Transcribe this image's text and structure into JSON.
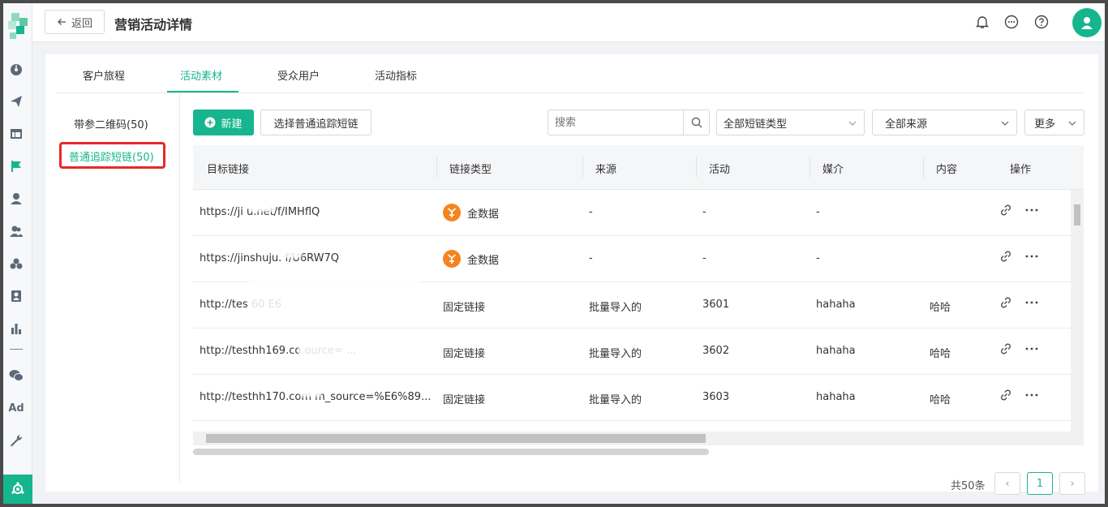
{
  "header": {
    "back_label": "返回",
    "title": "营销活动详情"
  },
  "sidebar": {
    "items": [
      "dashboard-icon",
      "send-icon",
      "layout-icon",
      "flag-icon",
      "user-icon",
      "users-icon",
      "group-icon",
      "bookmark-user-icon",
      "bar-chart-icon",
      "wechat-icon",
      "ad-icon",
      "wrench-icon"
    ],
    "ad_text": "Ad"
  },
  "tabs": [
    {
      "label": "客户旅程"
    },
    {
      "label": "活动素材"
    },
    {
      "label": "受众用户"
    },
    {
      "label": "活动指标"
    }
  ],
  "left_menu": [
    {
      "label": "带参二维码(50)"
    },
    {
      "label": "普通追踪短链(50)"
    }
  ],
  "toolbar": {
    "new_label": "新建",
    "select_label": "选择普通追踪短链",
    "search_placeholder": "搜索",
    "filter_type": "全部短链类型",
    "filter_source": "全部来源",
    "more_label": "更多"
  },
  "table": {
    "columns": [
      "目标链接",
      "链接类型",
      "来源",
      "活动",
      "媒介",
      "内容",
      "操作"
    ],
    "rows": [
      {
        "url": "https://ji       u.net/f/IMHflQ",
        "type": "金数据",
        "source": "-",
        "activity": "-",
        "medium": "-",
        "content": ""
      },
      {
        "url": "https://jinshuju.     f/U6RW7Q",
        "type": "金数据",
        "source": "-",
        "activity": "-",
        "medium": "-",
        "content": ""
      },
      {
        "url": "http://tes                 60      E6",
        "type": "固定链接",
        "source": "批量导入的",
        "activity": "3601",
        "medium": "hahaha",
        "content": "哈哈"
      },
      {
        "url": "http://testhh169.co         ource=           ...",
        "type": "固定链接",
        "source": "批量导入的",
        "activity": "3602",
        "medium": "hahaha",
        "content": "哈哈"
      },
      {
        "url": "http://testhh170.com     m_source=%E6%89...",
        "type": "固定链接",
        "source": "批量导入的",
        "activity": "3603",
        "medium": "hahaha",
        "content": "哈哈"
      }
    ]
  },
  "pager": {
    "total": "共50条",
    "current": "1",
    "prev": "‹",
    "next": "›"
  },
  "colors": {
    "accent": "#17b58e",
    "highlight": "#e52a2a",
    "jinshuju": "#f5841f"
  }
}
